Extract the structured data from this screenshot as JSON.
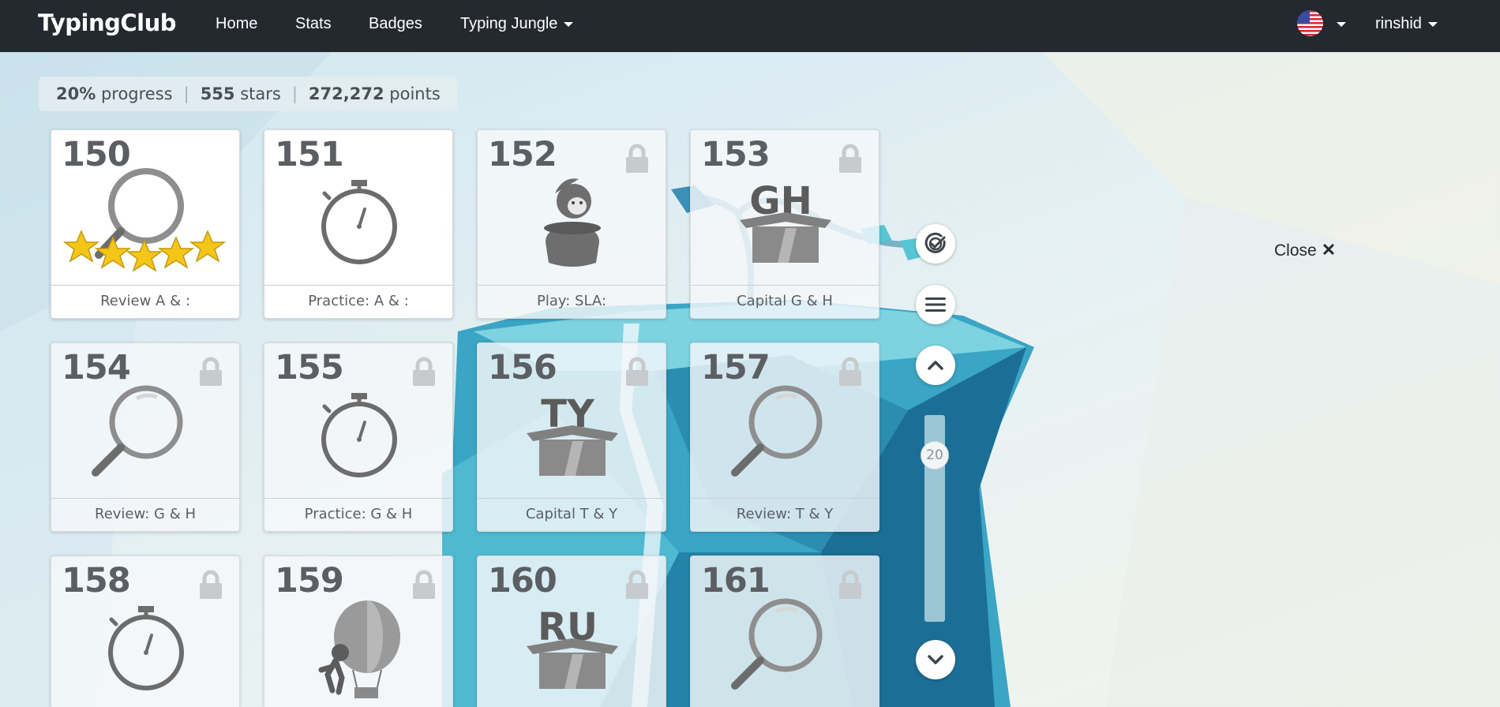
{
  "navbar": {
    "brand": "TypingClub",
    "links": [
      "Home",
      "Stats",
      "Badges",
      "Typing Jungle"
    ],
    "user": "rinshid"
  },
  "progress": {
    "percent": "20%",
    "percent_label": "progress",
    "stars": "555",
    "stars_label": "stars",
    "points": "272,272",
    "points_label": "points"
  },
  "lessons": [
    {
      "num": "150",
      "label": "Review A & :",
      "icon": "magnifier-stars-icon",
      "locked": false
    },
    {
      "num": "151",
      "label": "Practice: A & :",
      "icon": "stopwatch-icon",
      "locked": false
    },
    {
      "num": "152",
      "label": "Play: SLA:",
      "icon": "game-character-icon",
      "locked": true
    },
    {
      "num": "153",
      "label": "Capital G & H",
      "icon": "letter-box-icon",
      "box_letters": "GH",
      "locked": true
    },
    {
      "num": "154",
      "label": "Review: G & H",
      "icon": "magnifier-icon",
      "locked": true
    },
    {
      "num": "155",
      "label": "Practice: G & H",
      "icon": "stopwatch-icon",
      "locked": true
    },
    {
      "num": "156",
      "label": "Capital T & Y",
      "icon": "letter-box-icon",
      "box_letters": "TY",
      "locked": true
    },
    {
      "num": "157",
      "label": "Review: T & Y",
      "icon": "magnifier-icon",
      "locked": true
    },
    {
      "num": "158",
      "label": "",
      "icon": "stopwatch-icon",
      "locked": true
    },
    {
      "num": "159",
      "label": "",
      "icon": "balloon-icon",
      "locked": true
    },
    {
      "num": "160",
      "label": "",
      "icon": "letter-box-icon",
      "box_letters": "RU",
      "locked": true
    },
    {
      "num": "161",
      "label": "",
      "icon": "magnifier-icon",
      "locked": true
    }
  ],
  "side_controls": {
    "scroll_value": "20",
    "close_label": "Close"
  }
}
